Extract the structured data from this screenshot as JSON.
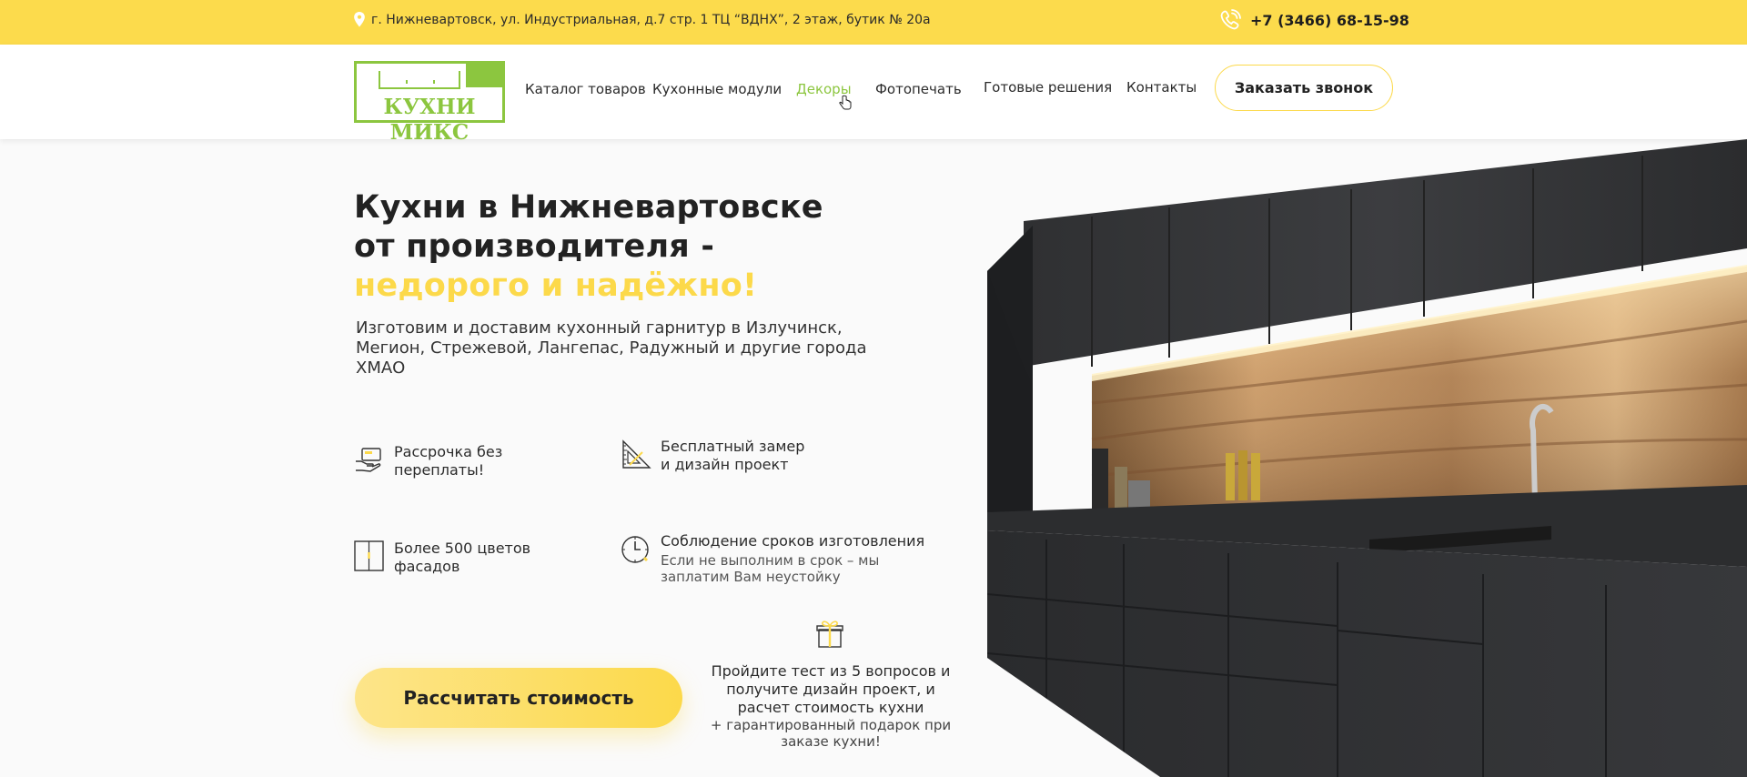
{
  "topbar": {
    "address": "г. Нижневартовск, ул. Индустриальная, д.7 стр. 1 ТЦ “ВДНХ”, 2 этаж, бутик № 20а",
    "phone": "+7 (3466) 68-15-98"
  },
  "header": {
    "logo_text": "КУХНИ МИКС",
    "nav": [
      {
        "label": "Каталог товаров"
      },
      {
        "label": "Кухонные модули"
      },
      {
        "label": "Декоры"
      },
      {
        "label": "Фотопечать"
      },
      {
        "label": "Готовые решения"
      },
      {
        "label": "Контакты"
      }
    ],
    "callback_button": "Заказать звонок"
  },
  "hero": {
    "title_line1": "Кухни в Нижневартовске",
    "title_line2": "от производителя -",
    "title_accent": "недорого и надёжно!",
    "subtitle": "Изготовим и доставим кухонный гарнитур в Излучинск, Мегион, Стрежевой, Лангепас, Радужный и другие города ХМАО"
  },
  "features": [
    {
      "icon": "installment-hand-icon",
      "line1": "Рассрочка без",
      "line2": "переплаты!"
    },
    {
      "icon": "ruler-triangle-icon",
      "line1": "Бесплатный замер",
      "line2": "и дизайн проект"
    },
    {
      "icon": "facade-door-icon",
      "line1": "Более 500 цветов",
      "line2": "фасадов"
    },
    {
      "icon": "clock-icon",
      "line1": "Соблюдение сроков изготовления",
      "note": "Если не выполним в срок – мы заплатим Вам неустойку"
    }
  ],
  "cta": {
    "calc_button": "Рассчитать стоимость",
    "quiz_text": "Пройдите тест из 5 вопросов и получите дизайн проект, и расчет стоимость кухни",
    "quiz_note": "+ гарантированный подарок при заказе кухни!"
  },
  "colors": {
    "accent_yellow": "#fcd94a",
    "logo_green": "#8cc63f"
  }
}
